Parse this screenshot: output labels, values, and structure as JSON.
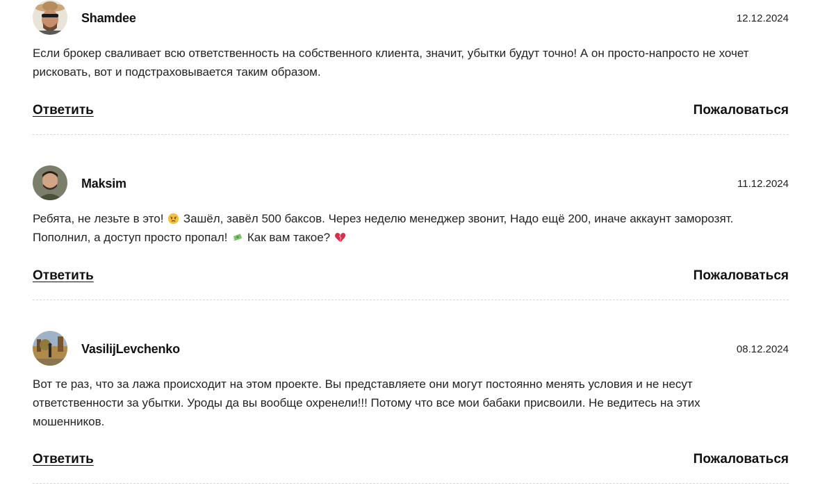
{
  "comments": [
    {
      "author": "Shamdee",
      "date": "12.12.2024",
      "text": "Если брокер сваливает всю ответственность на собственного клиента, значит, убытки будут точно! А он просто-напросто не хочет рисковать, вот и подстраховывается таким образом.",
      "reply_label": "Ответить",
      "complain_label": "Пожаловаться",
      "avatar_icon": "avatar-photo-hat-sunglasses"
    },
    {
      "author": "Maksim",
      "date": "11.12.2024",
      "text_part1": "Ребята, не лезьте в это!",
      "emoji1": "angry-face-emoji",
      "text_part2": "Зашёл, завёл 500 баксов. Через неделю менеджер звонит, Надо ещё 200, иначе аккаунт заморозят.",
      "text_part3": "Пополнил, а доступ просто пропал!",
      "emoji2": "money-with-wings-emoji",
      "text_part4": "Как вам такое?",
      "emoji3": "broken-heart-emoji",
      "reply_label": "Ответить",
      "complain_label": "Пожаловаться",
      "avatar_icon": "avatar-photo-man"
    },
    {
      "author": "VasilijLevchenko",
      "date": "08.12.2024",
      "text": "Вот те раз, что за лажа происходит на этом проекте. Вы представляете они могут постоянно менять условия и не несут ответственности за убытки. Уроды да вы вообще охренели!!! Потому что все мои бабаки присвоили. Не ведитесь на этих мошенников.",
      "reply_label": "Ответить",
      "complain_label": "Пожаловаться",
      "avatar_icon": "avatar-photo-landscape"
    }
  ],
  "colors": {
    "text": "#222222",
    "divider": "#d8d8d8",
    "background": "#ffffff"
  }
}
